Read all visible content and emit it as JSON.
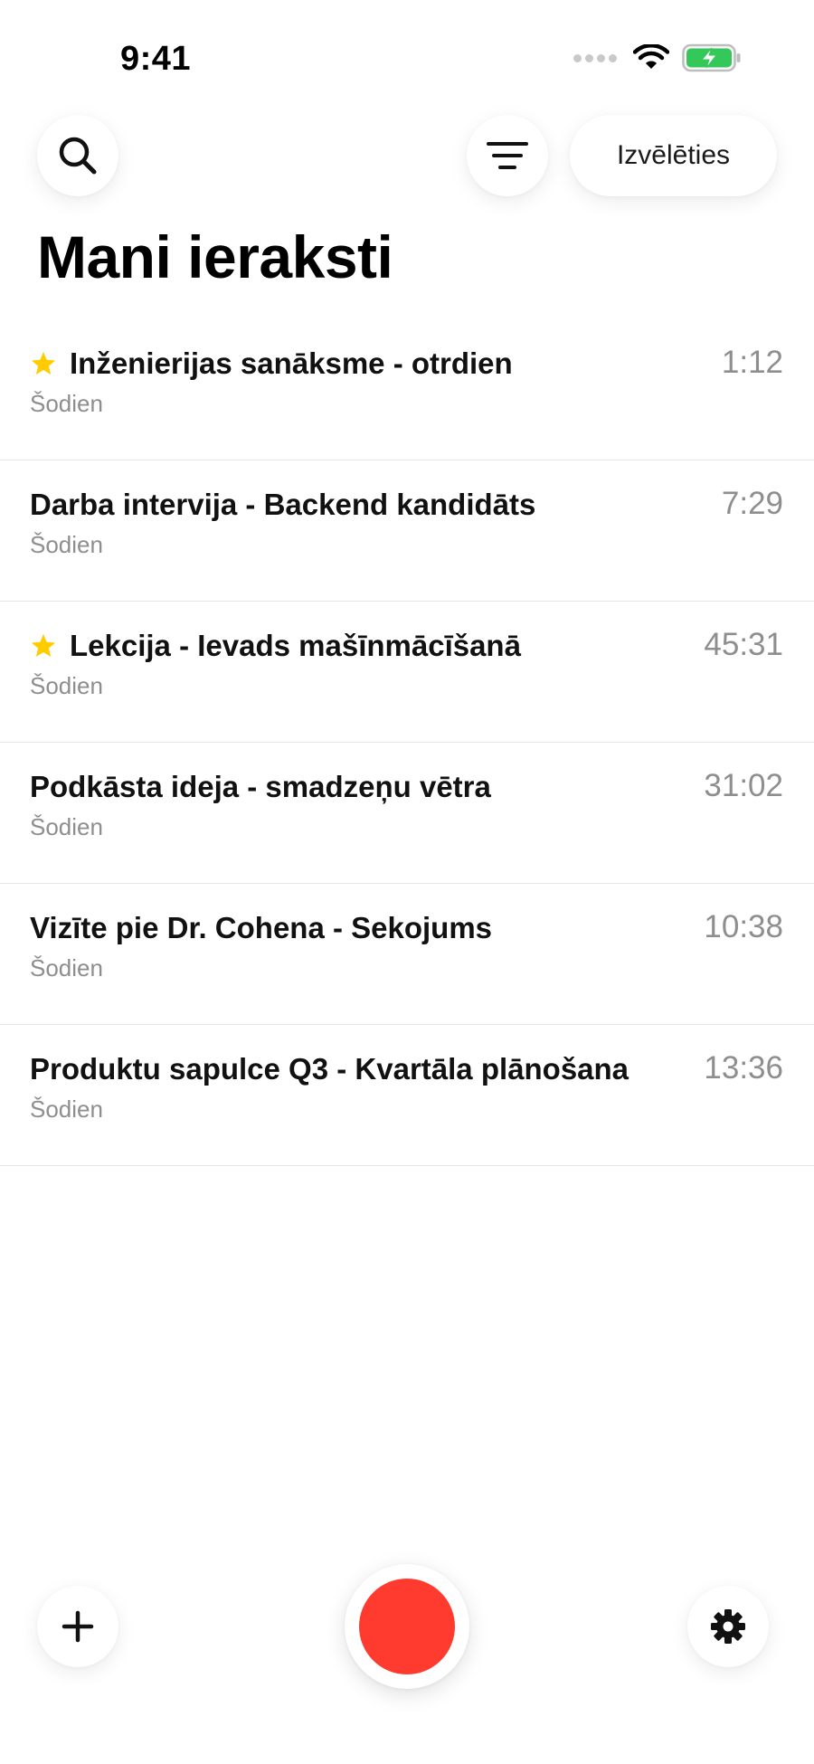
{
  "status_bar": {
    "time": "9:41",
    "icons": [
      "signal-dots",
      "wifi-icon",
      "battery-charging-icon"
    ],
    "battery_color": "#34c759"
  },
  "header": {
    "search_icon": "search-icon",
    "filter_icon": "sort-filter-icon",
    "select_label": "Izvēlēties",
    "title": "Mani ieraksti"
  },
  "recordings": [
    {
      "title": "Inženierijas sanāksme - otrdien",
      "date": "Šodien",
      "duration": "1:12",
      "starred": true
    },
    {
      "title": "Darba intervija - Backend kandidāts",
      "date": "Šodien",
      "duration": "7:29",
      "starred": false
    },
    {
      "title": "Lekcija - Ievads mašīnmācīšanā",
      "date": "Šodien",
      "duration": "45:31",
      "starred": true
    },
    {
      "title": "Podkāsta ideja - smadzeņu vētra",
      "date": "Šodien",
      "duration": "31:02",
      "starred": false
    },
    {
      "title": "Vizīte pie Dr. Cohena - Sekojums",
      "date": "Šodien",
      "duration": "10:38",
      "starred": false
    },
    {
      "title": "Produktu sapulce Q3 - Kvartāla plānošana",
      "date": "Šodien",
      "duration": "13:36",
      "starred": false
    }
  ],
  "bottom_bar": {
    "add_icon": "plus-icon",
    "record_icon": "record-icon",
    "settings_icon": "gear-icon",
    "record_color": "#ff3b30",
    "star_color": "#ffcc00"
  }
}
